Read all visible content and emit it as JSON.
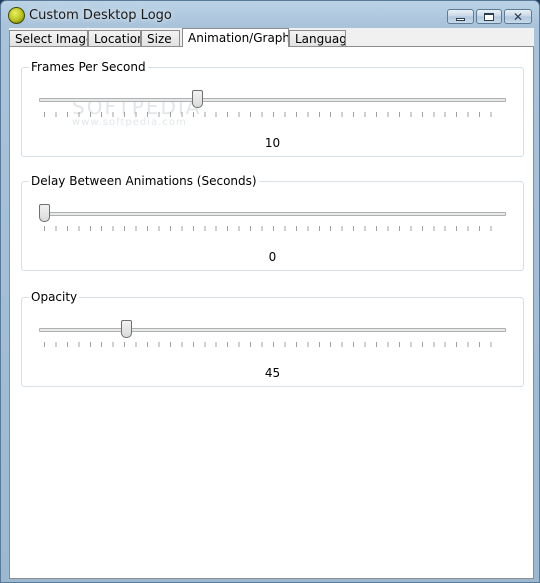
{
  "window": {
    "title": "Custom Desktop Logo",
    "icon": "app-logo-icon",
    "controls": {
      "minimize": "minimize-icon",
      "maximize": "maximize-icon",
      "close": "close-icon"
    }
  },
  "tabs": [
    {
      "label": "Select Images"
    },
    {
      "label": "Location"
    },
    {
      "label": "Size"
    },
    {
      "label": "Animation/Graphics",
      "selected": true
    },
    {
      "label": "Language"
    }
  ],
  "watermark": {
    "main": "SOFTPEDIA",
    "sub": "www.softpedia.com"
  },
  "groups": {
    "fps": {
      "label": "Frames Per Second",
      "value": "10",
      "slider_fraction": 0.335
    },
    "delay": {
      "label": "Delay Between Animations (Seconds)",
      "value": "0",
      "slider_fraction": 0.0
    },
    "opacity": {
      "label": "Opacity",
      "value": "45",
      "slider_fraction": 0.18
    }
  },
  "colors": {
    "title_bar": "#bcd3e6",
    "panel_bg": "#ffffff",
    "group_border": "#d5dfe5"
  }
}
